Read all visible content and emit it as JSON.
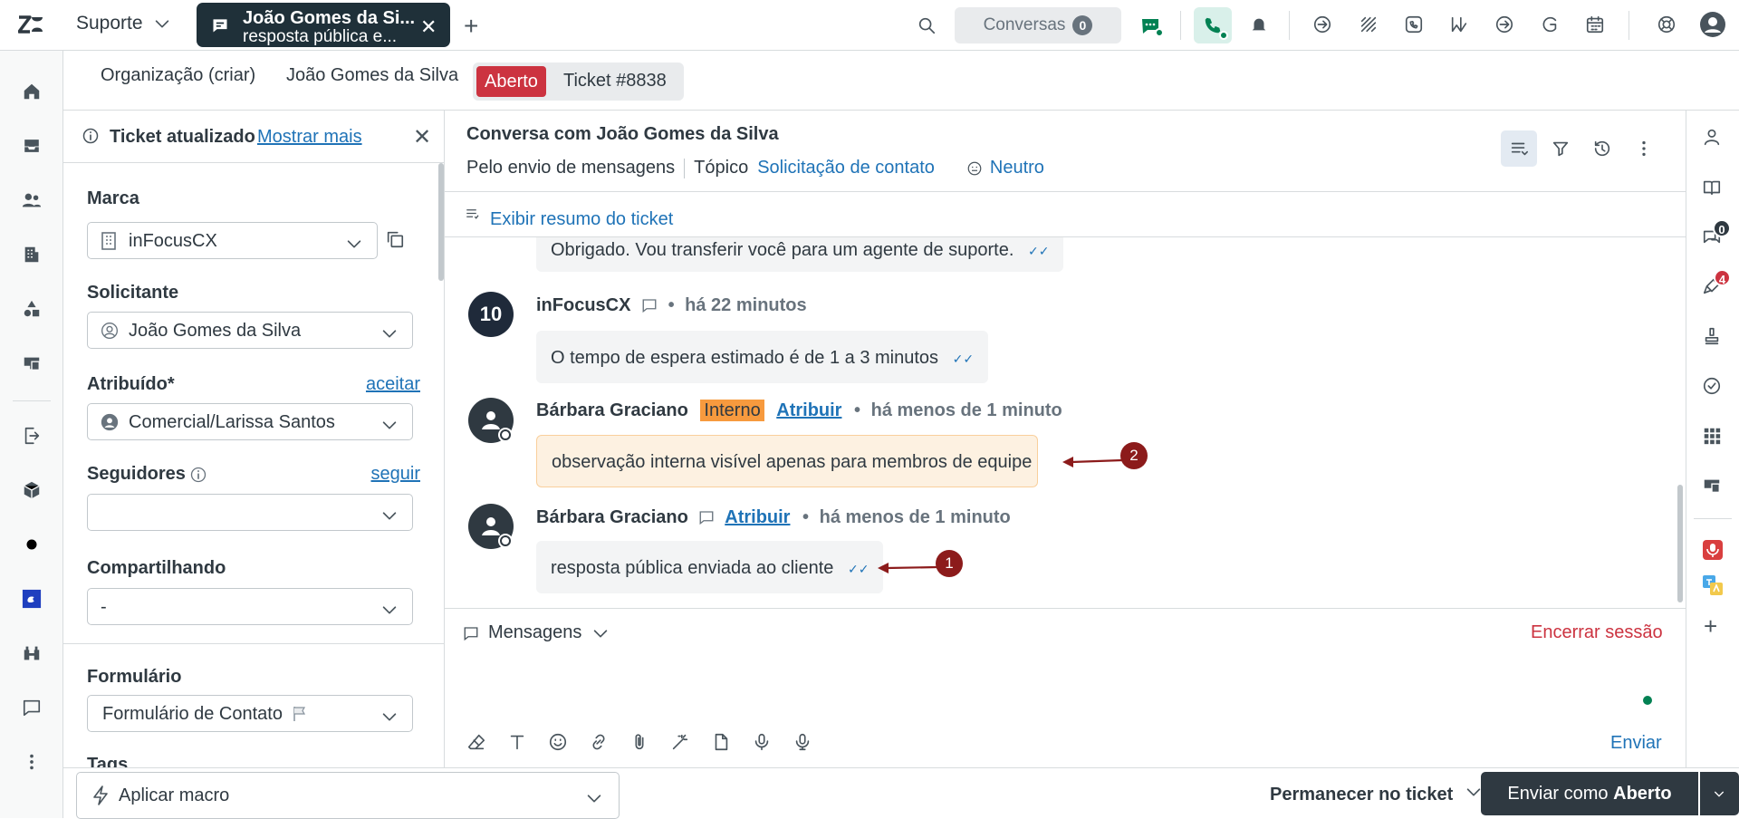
{
  "topbar": {
    "product": "Suporte",
    "active_tab": {
      "title": "João Gomes da Si...",
      "subtitle": "resposta pública e..."
    },
    "conversations": {
      "label": "Conversas",
      "count": "0"
    }
  },
  "ticket_tabs": {
    "organization": "Organização (criar)",
    "requester": "João Gomes da Silva",
    "status": "Aberto",
    "ticket": "Ticket #8838"
  },
  "notice": {
    "title": "Ticket atualizado",
    "link": "Mostrar mais"
  },
  "fields": {
    "brand": {
      "label": "Marca",
      "value": "inFocusCX"
    },
    "requester": {
      "label": "Solicitante",
      "value": "João Gomes da Silva"
    },
    "assignee": {
      "label": "Atribuído*",
      "action": "aceitar",
      "value": "Comercial/Larissa Santos"
    },
    "followers": {
      "label": "Seguidores",
      "action": "seguir",
      "value": ""
    },
    "sharing": {
      "label": "Compartilhando",
      "value": "-"
    },
    "form": {
      "label": "Formulário",
      "value": "Formulário de Contato"
    },
    "tags": {
      "label": "Tags"
    }
  },
  "conversation": {
    "title": "Conversa com João Gomes da Silva",
    "channel": "Pelo envio de mensagens",
    "topic_label": "Tópico",
    "topic_value": "Solicitação de contato",
    "sentiment": "Neutro",
    "summary": "Exibir resumo do ticket",
    "messages": [
      {
        "text": "Obrigado. Vou transferir você para um agente de suporte."
      },
      {
        "author": "inFocusCX",
        "time": "há 22 minutos",
        "avatar": "10",
        "text": "O tempo de espera estimado é de 1 a 3 minutos"
      },
      {
        "author": "Bárbara Graciano",
        "badge": "Interno",
        "assign": "Atribuir",
        "time": "há menos de 1 minuto",
        "text": "observação interna visível apenas para membros de equipe",
        "marker": "2"
      },
      {
        "author": "Bárbara Graciano",
        "assign": "Atribuir",
        "time": "há menos de 1 minuto",
        "text": "resposta pública enviada ao cliente",
        "marker": "1"
      }
    ]
  },
  "composer": {
    "channel": "Mensagens",
    "end_session": "Encerrar sessão",
    "send": "Enviar"
  },
  "bottom": {
    "macro": "Aplicar macro",
    "stay": "Permanecer no ticket",
    "submit_prefix": "Enviar como",
    "submit_status": "Aberto"
  },
  "right_rail": {
    "chat_badge": "0",
    "alert_badge": "4"
  },
  "colors": {
    "brand_dark": "#2f3941",
    "link": "#1f73b7",
    "open_red": "#cc3340",
    "internal_note_bg": "#fdf1e1",
    "marker": "#8c1b1b"
  }
}
